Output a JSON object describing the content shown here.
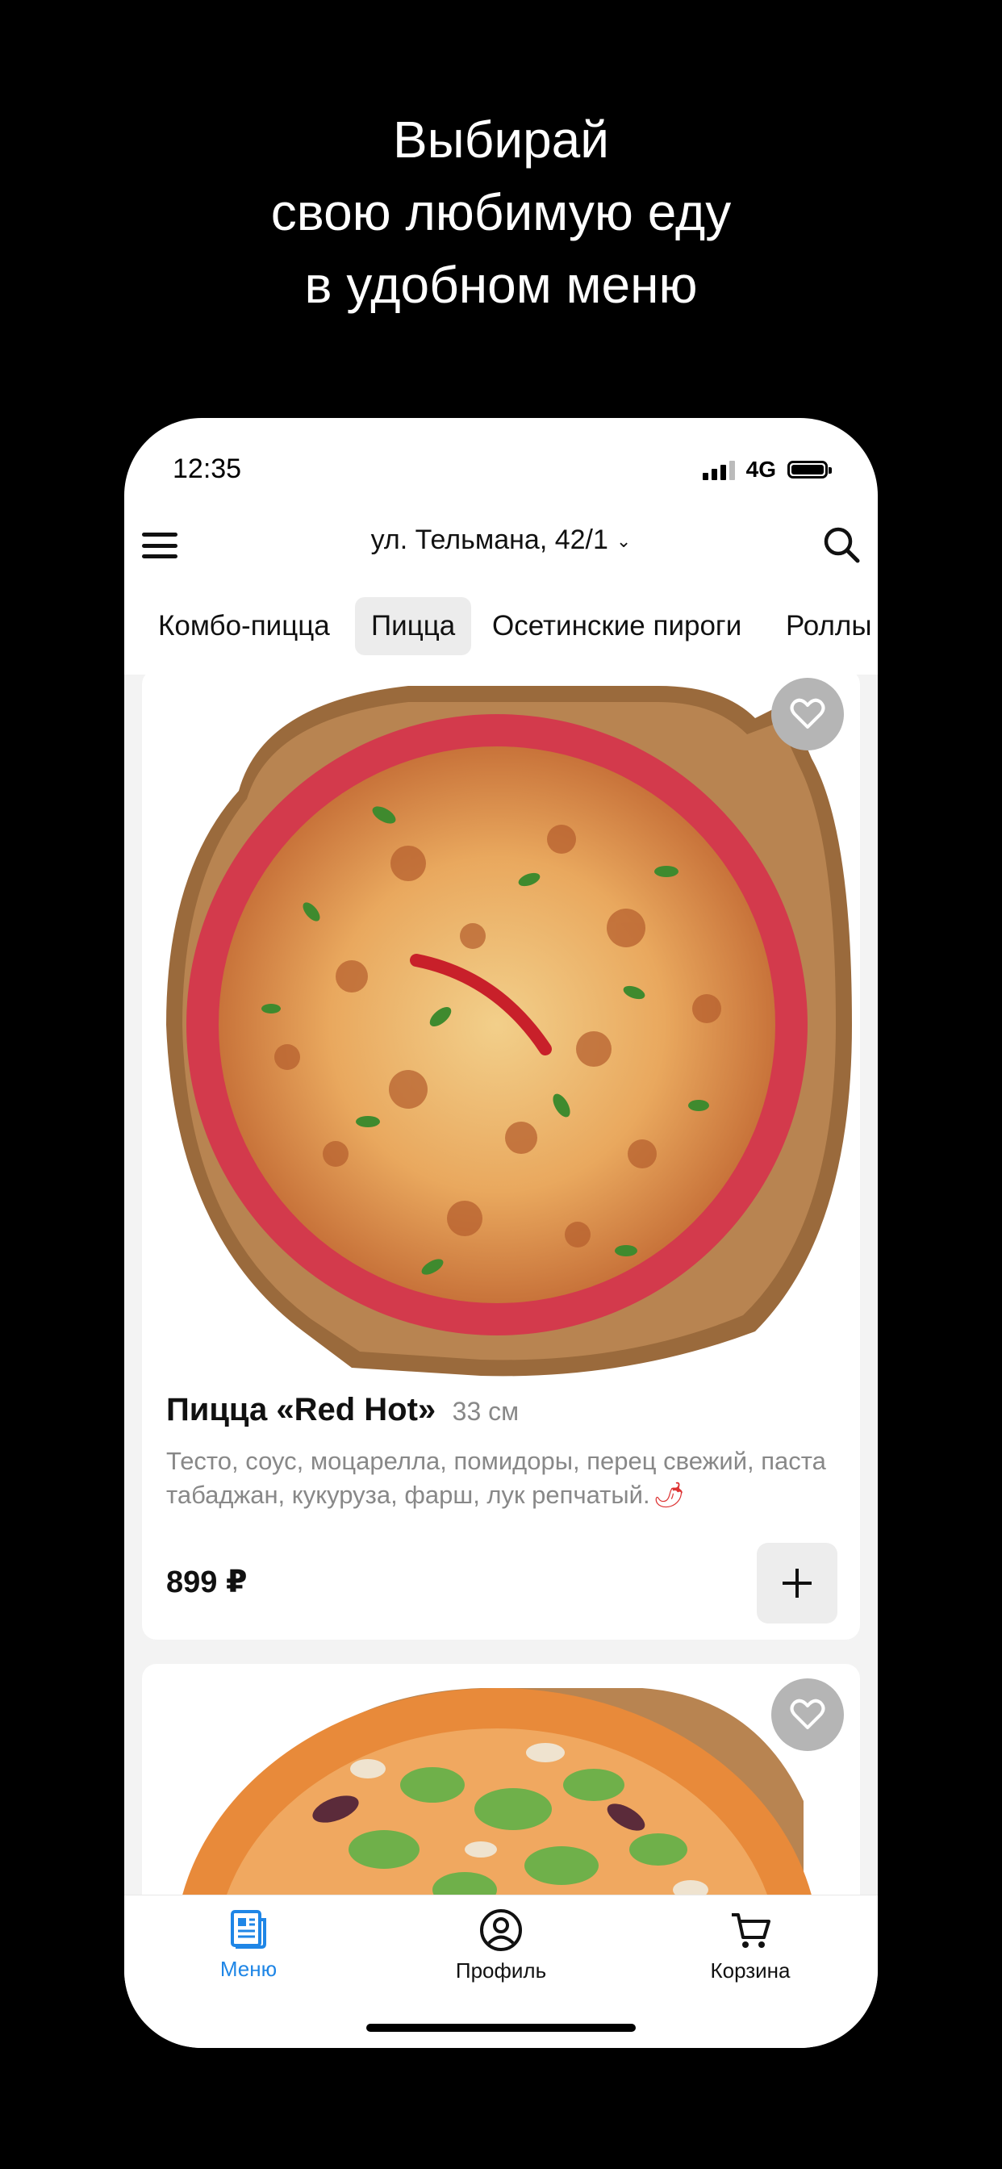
{
  "headline": {
    "line1": "Выбирай",
    "line2": "свою любимую еду",
    "line3": "в удобном меню"
  },
  "status_bar": {
    "time": "12:35",
    "network": "4G"
  },
  "header": {
    "address": "ул. Тельмана, 42/1",
    "menu_icon": "hamburger-icon",
    "search_icon": "search-icon"
  },
  "categories": [
    {
      "label": "Комбо-пицца",
      "active": false
    },
    {
      "label": "Пицца",
      "active": true
    },
    {
      "label": "Осетинские пироги",
      "active": false
    },
    {
      "label": "Роллы",
      "active": false
    }
  ],
  "products": [
    {
      "name": "Пицца «Red Hot»",
      "size": "33 см",
      "description": "Тесто, соус, моцарелла, помидоры, перец свежий, паста табаджан, кукуруза, фарш, лук репчатый.",
      "price": "899 ₽"
    }
  ],
  "tabbar": {
    "items": [
      {
        "label": "Меню",
        "icon": "menu-document-icon",
        "active": true
      },
      {
        "label": "Профиль",
        "icon": "profile-icon",
        "active": false
      },
      {
        "label": "Корзина",
        "icon": "cart-icon",
        "active": false
      }
    ]
  },
  "colors": {
    "accent": "#1f86e6",
    "background": "#000000",
    "muted_text": "#888888"
  }
}
